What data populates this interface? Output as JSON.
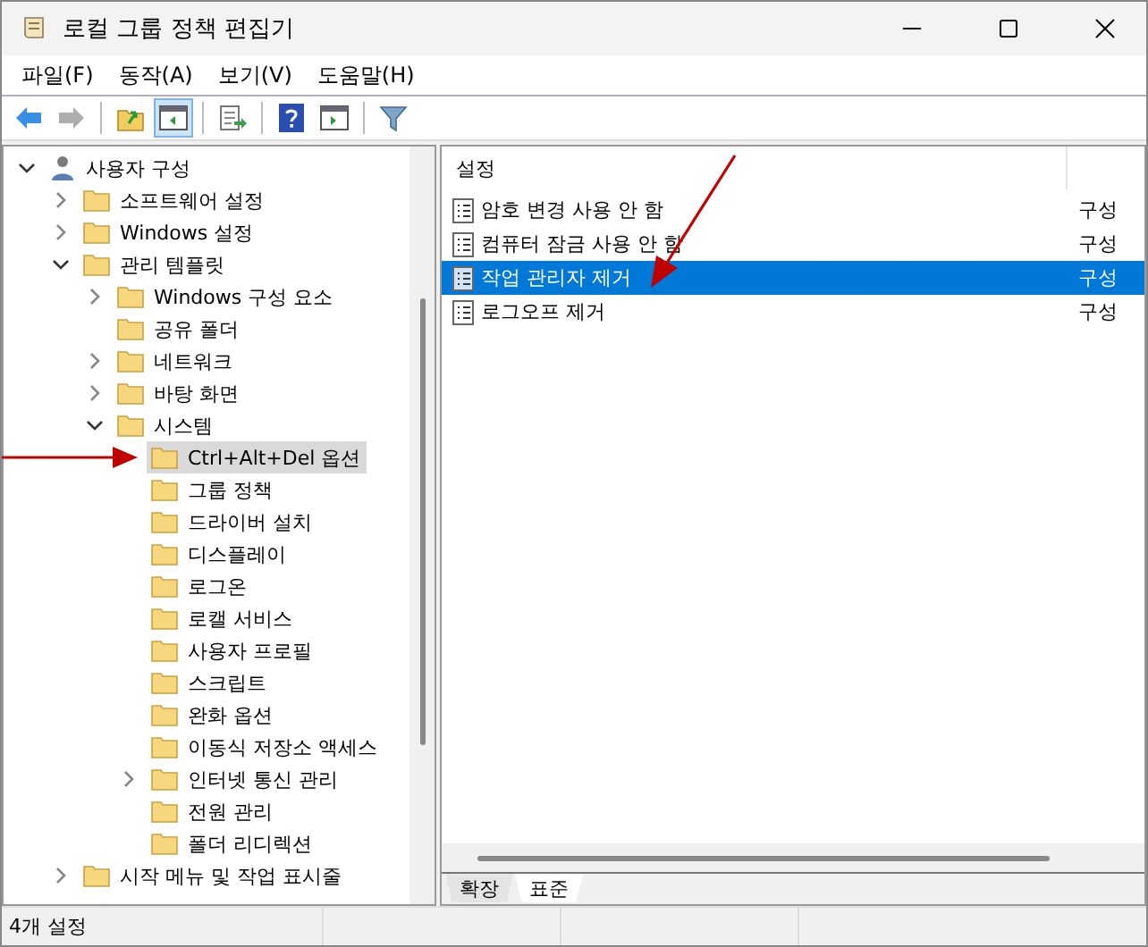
{
  "window": {
    "title": "로컬 그룹 정책 편집기"
  },
  "menu": [
    "파일(F)",
    "동작(A)",
    "보기(V)",
    "도움말(H)"
  ],
  "toolbar": [
    {
      "kind": "back",
      "disabled": false,
      "pressed": false
    },
    {
      "kind": "forward",
      "disabled": true,
      "pressed": false
    },
    {
      "kind": "sep"
    },
    {
      "kind": "up",
      "disabled": false,
      "pressed": false
    },
    {
      "kind": "tree",
      "disabled": false,
      "pressed": true
    },
    {
      "kind": "sep"
    },
    {
      "kind": "export",
      "disabled": false,
      "pressed": false
    },
    {
      "kind": "sep"
    },
    {
      "kind": "help",
      "disabled": false,
      "pressed": false
    },
    {
      "kind": "pane",
      "disabled": false,
      "pressed": false
    },
    {
      "kind": "sep"
    },
    {
      "kind": "filter",
      "disabled": false,
      "pressed": false
    }
  ],
  "tree": [
    {
      "label": "사용자 구성",
      "kind": "user",
      "expanded": true,
      "selected": false,
      "children": [
        {
          "label": "소프트웨어 설정",
          "kind": "folder",
          "expanded": false,
          "selected": false
        },
        {
          "label": "Windows 설정",
          "kind": "folder",
          "expanded": false,
          "selected": false
        },
        {
          "label": "관리 템플릿",
          "kind": "folder",
          "expanded": true,
          "selected": false,
          "children": [
            {
              "label": "Windows 구성 요소",
              "kind": "folder",
              "expanded": false,
              "selected": false
            },
            {
              "label": "공유 폴더",
              "kind": "folder",
              "selected": false
            },
            {
              "label": "네트워크",
              "kind": "folder",
              "expanded": false,
              "selected": false
            },
            {
              "label": "바탕 화면",
              "kind": "folder",
              "expanded": false,
              "selected": false
            },
            {
              "label": "시스템",
              "kind": "folder",
              "expanded": true,
              "selected": false,
              "children": [
                {
                  "label": "Ctrl+Alt+Del 옵션",
                  "kind": "folder",
                  "selected": true
                },
                {
                  "label": "그룹 정책",
                  "kind": "folder",
                  "selected": false
                },
                {
                  "label": "드라이버 설치",
                  "kind": "folder",
                  "selected": false
                },
                {
                  "label": "디스플레이",
                  "kind": "folder",
                  "selected": false
                },
                {
                  "label": "로그온",
                  "kind": "folder",
                  "selected": false
                },
                {
                  "label": "로캘 서비스",
                  "kind": "folder",
                  "selected": false
                },
                {
                  "label": "사용자 프로필",
                  "kind": "folder",
                  "selected": false
                },
                {
                  "label": "스크립트",
                  "kind": "folder",
                  "selected": false
                },
                {
                  "label": "완화 옵션",
                  "kind": "folder",
                  "selected": false
                },
                {
                  "label": "이동식 저장소 액세스",
                  "kind": "folder",
                  "selected": false
                },
                {
                  "label": "인터넷 통신 관리",
                  "kind": "folder",
                  "expanded": false,
                  "selected": false
                },
                {
                  "label": "전원 관리",
                  "kind": "folder",
                  "selected": false
                },
                {
                  "label": "폴더 리디렉션",
                  "kind": "folder",
                  "selected": false
                }
              ]
            }
          ]
        },
        {
          "label": "시작 메뉴 및 작업 표시줄",
          "kind": "folder",
          "expanded": false,
          "selected": false
        }
      ]
    }
  ],
  "list": {
    "columns": [
      "설정"
    ],
    "rows": [
      {
        "name": "암호 변경 사용 안 함",
        "state": "구성",
        "selected": false
      },
      {
        "name": "컴퓨터 잠금 사용 안 함",
        "state": "구성",
        "selected": false
      },
      {
        "name": "작업 관리자 제거",
        "state": "구성",
        "selected": true
      },
      {
        "name": "로그오프 제거",
        "state": "구성",
        "selected": false
      }
    ]
  },
  "tabs": [
    {
      "label": "확장",
      "selected": false
    },
    {
      "label": "표준",
      "selected": true
    }
  ],
  "status_bar": "4개 설정"
}
